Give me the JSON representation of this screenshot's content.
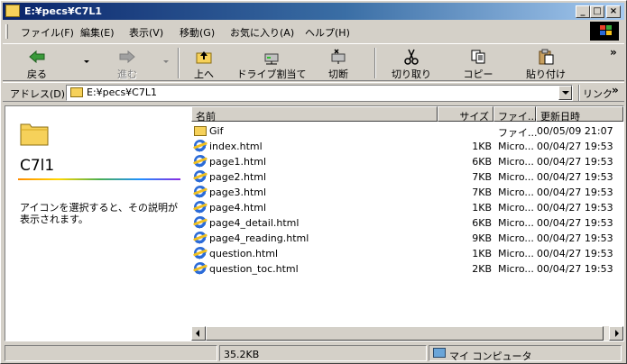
{
  "window": {
    "title": "E:¥pecs¥C7L1",
    "controls": {
      "minimize": "_",
      "maximize": "□",
      "close": "×"
    }
  },
  "menu": {
    "items": [
      {
        "label": "ファイル(F)"
      },
      {
        "label": "編集(E)"
      },
      {
        "label": "表示(V)"
      },
      {
        "label": "移動(G)"
      },
      {
        "label": "お気に入り(A)"
      },
      {
        "label": "ヘルプ(H)"
      }
    ]
  },
  "toolbar": {
    "buttons": [
      {
        "label": "戻る",
        "icon": "back-arrow-icon",
        "enabled": true
      },
      {
        "label": "進む",
        "icon": "forward-arrow-icon",
        "enabled": false
      },
      {
        "label": "上へ",
        "icon": "up-folder-icon",
        "enabled": true
      },
      {
        "label": "ドライブ割当て",
        "icon": "map-drive-icon",
        "enabled": true
      },
      {
        "label": "切断",
        "icon": "disconnect-icon",
        "enabled": true
      },
      {
        "label": "切り取り",
        "icon": "scissors-icon",
        "enabled": true
      },
      {
        "label": "コピー",
        "icon": "copy-icon",
        "enabled": true
      },
      {
        "label": "貼り付け",
        "icon": "paste-icon",
        "enabled": true
      }
    ],
    "overflow": "»"
  },
  "address": {
    "label": "アドレス(D)",
    "value": "E:¥pecs¥C7L1",
    "links_label": "リンク",
    "links_overflow": "»"
  },
  "left_pane": {
    "folder_name": "C7l1",
    "hint": "アイコンを選択すると、その説明が表示されます。"
  },
  "file_list": {
    "columns": [
      "名前",
      "サイズ",
      "ファイ...",
      "更新日時"
    ],
    "rows": [
      {
        "name": "Gif",
        "size": "",
        "type": "ファイ...",
        "modified": "00/05/09 21:07",
        "icon": "folder-icon"
      },
      {
        "name": "index.html",
        "size": "1KB",
        "type": "Micro...",
        "modified": "00/04/27 19:53",
        "icon": "html-file-icon"
      },
      {
        "name": "page1.html",
        "size": "6KB",
        "type": "Micro...",
        "modified": "00/04/27 19:53",
        "icon": "html-file-icon"
      },
      {
        "name": "page2.html",
        "size": "7KB",
        "type": "Micro...",
        "modified": "00/04/27 19:53",
        "icon": "html-file-icon"
      },
      {
        "name": "page3.html",
        "size": "7KB",
        "type": "Micro...",
        "modified": "00/04/27 19:53",
        "icon": "html-file-icon"
      },
      {
        "name": "page4.html",
        "size": "1KB",
        "type": "Micro...",
        "modified": "00/04/27 19:53",
        "icon": "html-file-icon"
      },
      {
        "name": "page4_detail.html",
        "size": "6KB",
        "type": "Micro...",
        "modified": "00/04/27 19:53",
        "icon": "html-file-icon"
      },
      {
        "name": "page4_reading.html",
        "size": "9KB",
        "type": "Micro...",
        "modified": "00/04/27 19:53",
        "icon": "html-file-icon"
      },
      {
        "name": "question.html",
        "size": "1KB",
        "type": "Micro...",
        "modified": "00/04/27 19:53",
        "icon": "html-file-icon"
      },
      {
        "name": "question_toc.html",
        "size": "2KB",
        "type": "Micro...",
        "modified": "00/04/27 19:53",
        "icon": "html-file-icon"
      }
    ]
  },
  "status": {
    "size": "35.2KB",
    "location": "マイ コンピュータ"
  }
}
